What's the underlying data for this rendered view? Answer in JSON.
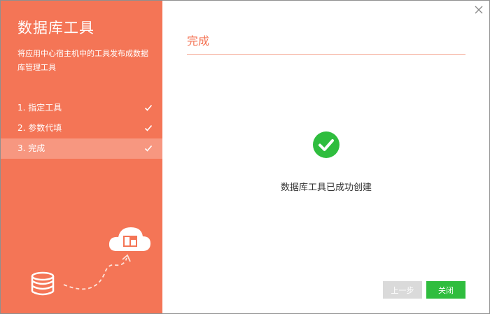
{
  "sidebar": {
    "title": "数据库工具",
    "description": "将应用中心宿主机中的工具发布成数据库管理工具",
    "steps": [
      {
        "label": "1. 指定工具",
        "done": true
      },
      {
        "label": "2. 参数代填",
        "done": true
      },
      {
        "label": "3. 完成",
        "done": true,
        "active": true
      }
    ]
  },
  "main": {
    "title": "完成",
    "message": "数据库工具已成功创建"
  },
  "buttons": {
    "prev": "上一步",
    "close": "关闭"
  },
  "colors": {
    "accent": "#f47556",
    "success": "#2fbd3e",
    "disabled": "#dadada"
  },
  "icons": {
    "close": "close-icon",
    "step_done": "check-icon",
    "success": "check-circle-icon",
    "illustration_db": "database-icon",
    "illustration_cloud": "cloud-icon"
  }
}
